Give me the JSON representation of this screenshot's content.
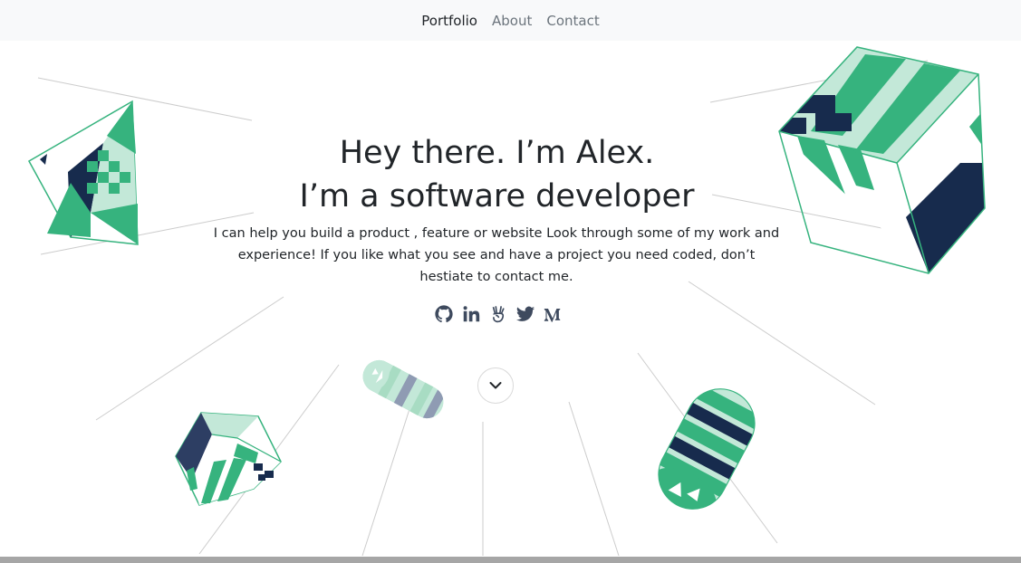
{
  "nav": {
    "items": [
      "Portfolio",
      "About",
      "Contact"
    ]
  },
  "hero": {
    "title_line1": "Hey there. I’m Alex.",
    "title_line2": "I’m a software developer",
    "lead": "I can help you build a product , feature or website Look through some of my work and experience! If you like what you see and have a project you need coded, don’t hestiate to contact me."
  },
  "social": [
    "github-icon",
    "linkedin-icon",
    "angellist-icon",
    "twitter-icon",
    "medium-icon"
  ],
  "colors": {
    "green": "#36b37e",
    "mint": "#c3e8d8",
    "navy": "#172b4d",
    "slate": "#8f9bb3",
    "line": "#cccccc",
    "text": "#212529"
  }
}
